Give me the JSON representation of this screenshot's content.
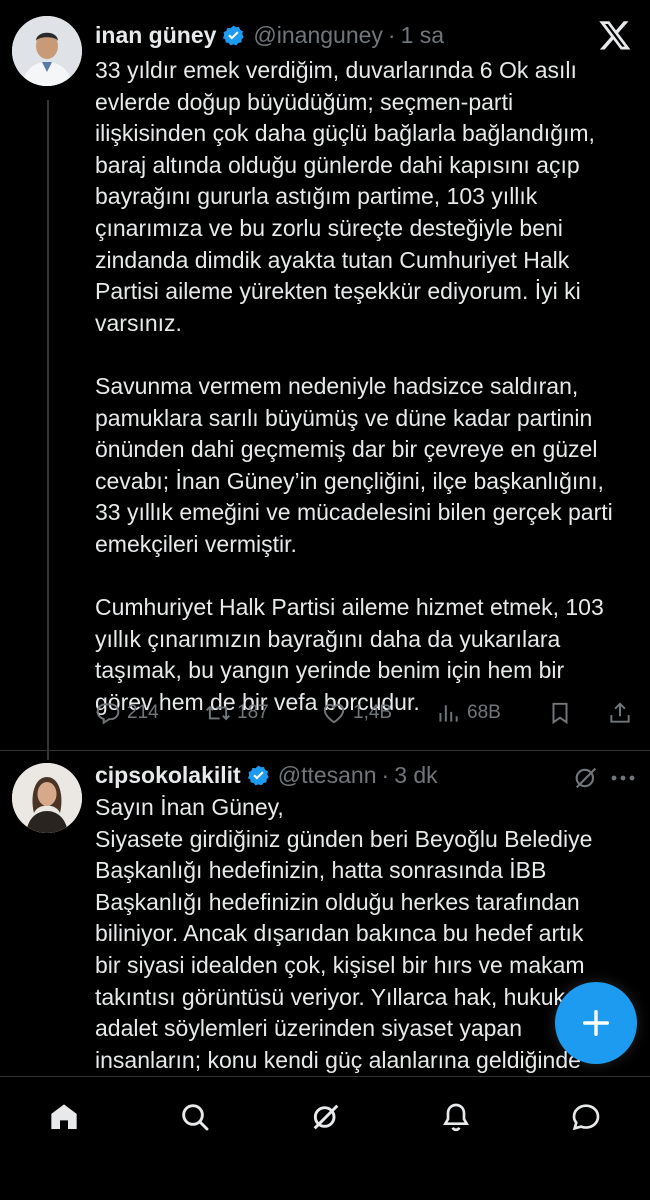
{
  "tweets": [
    {
      "author": "inan güney",
      "handle": "@inanguney",
      "separator": "·",
      "time": "1 sa",
      "paragraphs": [
        "33 yıldır emek verdiğim, duvarlarında 6 Ok asılı evlerde doğup büyüdüğüm; seçmen-parti ilişkisinden çok daha güçlü bağlarla bağlandığım, baraj altında olduğu günlerde dahi kapısını açıp bayrağını gururla astığım partime, 103 yıllık çınarımıza ve bu zorlu süreçte desteğiyle beni zindanda dimdik ayakta tutan Cumhuriyet Halk Partisi aileme yürekten teşekkür ediyorum. İyi ki varsınız.",
        "Savunma vermem nedeniyle hadsizce saldıran, pamuklara sarılı büyümüş ve düne kadar partinin önünden dahi geçmemiş dar bir çevreye en güzel cevabı; İnan Güney’in gençliğini, ilçe başkanlığını, 33 yıllık emeğini ve mücadelesini bilen gerçek parti emekçileri vermiştir.",
        "Cumhuriyet Halk Partisi aileme hizmet etmek, 103 yıllık çınarımızın bayrağını daha da yukarılara taşımak, bu yangın yerinde benim için hem bir görev hem de bir vefa borcudur."
      ],
      "stats": {
        "replies": "214",
        "reposts": "187",
        "likes": "1,4B",
        "views": "68B"
      }
    },
    {
      "author": "cipsokolakilit",
      "handle": "@ttesann",
      "separator": "·",
      "time": "3 dk",
      "paragraphs": [
        "Sayın İnan Güney,",
        "Siyasete girdiğiniz günden beri Beyoğlu Belediye Başkanlığı hedefinizin, hatta sonrasında İBB Başkanlığı hedefinizin olduğu herkes tarafından biliniyor. Ancak dışarıdan bakınca bu hedef artık bir siyasi idealden çok, kişisel bir hırs ve makam takıntısı görüntüsü veriyor. Yıllarca hak, hukuk, adalet söylemleri üzerinden siyaset yapan insanların; konu kendi güç alanlarına geldiğinde ise başka bir tavır takınması gerçekten düşündürücü."
      ]
    }
  ],
  "icons": {
    "close": "x-logo-icon",
    "verified": "verified-badge-icon",
    "reply": "reply-icon",
    "repost": "repost-icon",
    "like": "heart-icon",
    "views": "views-icon",
    "bookmark": "bookmark-icon",
    "share": "share-icon",
    "compose": "plus-icon",
    "nav": [
      "home-icon",
      "search-icon",
      "grok-icon",
      "notifications-icon",
      "messages-icon"
    ]
  },
  "colors": {
    "accent": "#1d9bf0",
    "background": "#000000",
    "text": "#e7e9ea",
    "muted": "#71767b"
  }
}
